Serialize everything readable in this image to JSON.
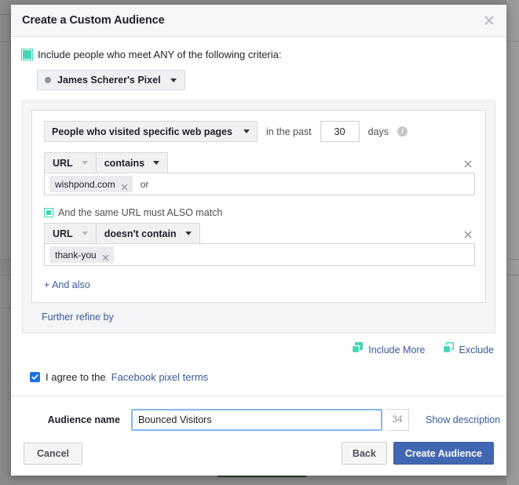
{
  "modal": {
    "title": "Create a Custom Audience",
    "close_icon": "close-icon"
  },
  "include": {
    "icon": "include-square-icon",
    "label": "Include people who meet ANY of the following criteria:"
  },
  "pixel_select": {
    "dot_icon": "pixel-status-dot-icon",
    "label": "James Scherer's Pixel",
    "caret_icon": "chevron-down-icon"
  },
  "rule": {
    "event_label": "People who visited specific web pages",
    "event_caret_icon": "chevron-down-icon",
    "in_the_past": "in the past",
    "days_value": "30",
    "days_label": "days",
    "info_icon": "info-icon",
    "info_glyph": "i",
    "conditions": [
      {
        "field_label": "URL",
        "field_caret_icon": "chevron-down-icon-disabled",
        "operator_label": "contains",
        "operator_caret_icon": "chevron-down-icon",
        "remove_icon": "close-icon",
        "tokens": [
          {
            "text": "wishpond.com",
            "remove_icon": "close-icon"
          }
        ],
        "or_label": "or"
      },
      {
        "field_label": "URL",
        "field_caret_icon": "chevron-down-icon-disabled",
        "operator_label": "doesn't contain",
        "operator_caret_icon": "chevron-down-icon",
        "remove_icon": "close-icon",
        "tokens": [
          {
            "text": "thank-you",
            "remove_icon": "close-icon"
          }
        ],
        "or_label": ""
      }
    ],
    "also_match": {
      "icon": "nested-square-icon",
      "label": "And the same URL must ALSO match"
    },
    "and_also_link": "+ And also"
  },
  "further_refine_link": "Further refine by",
  "actions": {
    "include_more": {
      "icon": "include-more-squares-icon",
      "label": "Include More"
    },
    "exclude": {
      "icon": "exclude-squares-icon",
      "label": "Exclude"
    }
  },
  "agree": {
    "checkbox_icon": "checkbox-checked-icon",
    "checked": true,
    "text": "I agree to the",
    "link": "Facebook pixel terms"
  },
  "audience_name": {
    "label": "Audience name",
    "value": "Bounced Visitors",
    "placeholder": "",
    "char_count": "34",
    "show_description_link": "Show description"
  },
  "footer": {
    "cancel_label": "Cancel",
    "back_label": "Back",
    "create_label": "Create Audience"
  },
  "colors": {
    "accent_teal": "#42d6b5",
    "link_blue": "#3b5998",
    "primary_button": "#4267b2",
    "checkbox_blue": "#1b74e4",
    "focus_border": "#85b6f5"
  }
}
